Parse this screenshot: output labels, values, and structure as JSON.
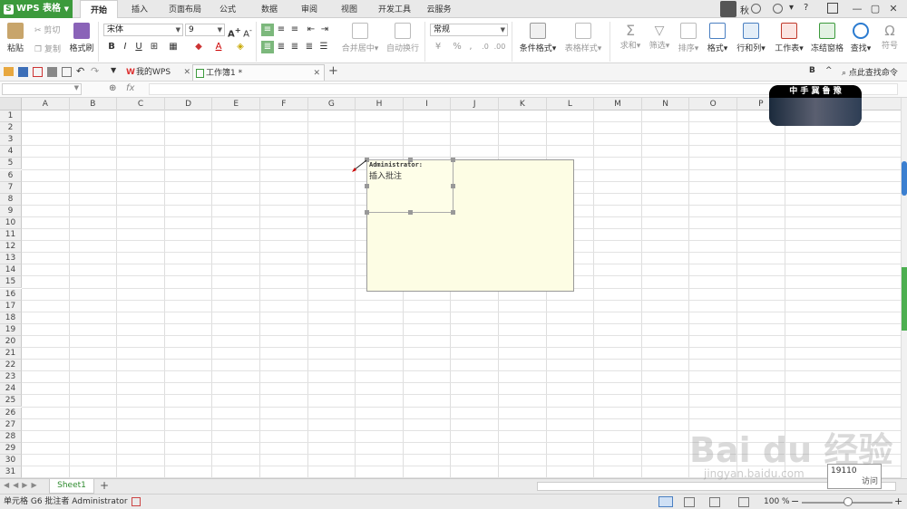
{
  "app": {
    "title": "WPS 表格",
    "accent": "#3c9a3c"
  },
  "tabs": [
    "开始",
    "插入",
    "页面布局",
    "公式",
    "数据",
    "审阅",
    "视图",
    "开发工具",
    "云服务"
  ],
  "user": {
    "name": "秋"
  },
  "ribbon": {
    "paste": "粘贴",
    "cut": "剪切",
    "copy": "复制",
    "format_painter": "格式刷",
    "font_name": "宋体",
    "font_size": "9",
    "bold": "B",
    "italic": "I",
    "underline": "U",
    "merge_center": "合并居中",
    "wrap_text": "自动换行",
    "number_format": "常规",
    "percent": "%",
    "cond_format": "条件格式",
    "table_style": "表格样式",
    "sum": "求和",
    "filter": "筛选",
    "sort": "排序",
    "format": "格式",
    "rows_cols": "行和列",
    "worksheet": "工作表",
    "freeze": "冻结窗格",
    "find": "查找",
    "symbol": "符号"
  },
  "doc_tabs": [
    {
      "label": "我的WPS"
    },
    {
      "label": "工作簿1 *"
    }
  ],
  "search_cmd": "点此查找命令",
  "formula": {
    "fx": "fx",
    "name_box": ""
  },
  "columns": [
    "A",
    "B",
    "C",
    "D",
    "E",
    "F",
    "G",
    "H",
    "I",
    "J",
    "K",
    "L",
    "M",
    "N",
    "O",
    "P"
  ],
  "rows": [
    "1",
    "2",
    "3",
    "4",
    "5",
    "6",
    "7",
    "8",
    "9",
    "10",
    "11",
    "12",
    "13",
    "14",
    "15",
    "16",
    "17",
    "18",
    "19",
    "20",
    "21",
    "22",
    "23",
    "24",
    "25",
    "26",
    "27",
    "28",
    "29",
    "30",
    "31"
  ],
  "comment": {
    "author": "Administrator:",
    "text": "插入批注"
  },
  "sheet": {
    "name": "Sheet1"
  },
  "status": {
    "text": "单元格 G6 批注者 Administrator",
    "zoom": "100 %"
  },
  "overlay": {
    "count": "19110",
    "label": "访问"
  },
  "watermark": {
    "badge": "中 手 冀 鲁 豫",
    "baidu": "Bai du 经验",
    "url": "jingyan.baidu.com"
  }
}
